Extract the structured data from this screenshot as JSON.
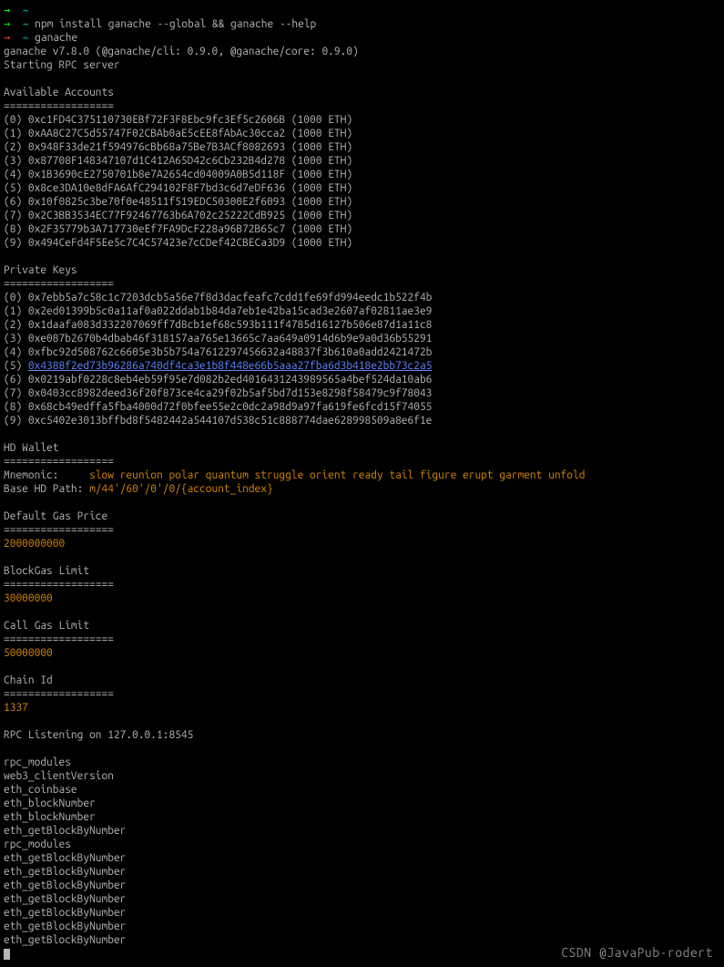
{
  "prompts": [
    {
      "arrow": "→",
      "arrowClass": "arrow-green",
      "tilde": "~",
      "command": ""
    },
    {
      "arrow": "→",
      "arrowClass": "arrow-green",
      "tilde": "~",
      "command": "npm install ganache --global && ganache --help"
    },
    {
      "arrow": "→",
      "arrowClass": "arrow-red",
      "tilde": "~",
      "command": "ganache"
    }
  ],
  "version_line": "ganache v7.8.0 (@ganache/cli: 0.9.0, @ganache/core: 0.9.0)",
  "starting_line": "Starting RPC server",
  "accounts_header": "Available Accounts",
  "separator": "==================",
  "accounts": [
    {
      "idx": "(0)",
      "addr": "0xc1FD4C375110730EBf72F3F8Ebc9fc3Ef5c2606B",
      "bal": "(1000 ETH)"
    },
    {
      "idx": "(1)",
      "addr": "0xAA8C27C5d55747F02CBAb0aE5cEE8fAbAc30cca2",
      "bal": "(1000 ETH)"
    },
    {
      "idx": "(2)",
      "addr": "0x948F33de21f594976cBb68a75Be7B3ACf8082693",
      "bal": "(1000 ETH)"
    },
    {
      "idx": "(3)",
      "addr": "0x87708F148347107d1C412A65D42c6Cb232B4d278",
      "bal": "(1000 ETH)"
    },
    {
      "idx": "(4)",
      "addr": "0x1B3690cE2750701b8e7A2654cd04009A0B5d118F",
      "bal": "(1000 ETH)"
    },
    {
      "idx": "(5)",
      "addr": "0x8ce3DA10e8dFA6AfC294102F8F7bd3c6d7eDF636",
      "bal": "(1000 ETH)"
    },
    {
      "idx": "(6)",
      "addr": "0x10f0825c3be70f0e48511f519EDC50300E2f6093",
      "bal": "(1000 ETH)"
    },
    {
      "idx": "(7)",
      "addr": "0x2C3BB3534EC77F92467763b6A702c25222CdB925",
      "bal": "(1000 ETH)"
    },
    {
      "idx": "(8)",
      "addr": "0x2F35779b3A717730eEf7FA9DcF228a96B72B65c7",
      "bal": "(1000 ETH)"
    },
    {
      "idx": "(9)",
      "addr": "0x494CeFd4F5Ee5c7C4C57423e7cCDef42CBECa3D9",
      "bal": "(1000 ETH)"
    }
  ],
  "pk_header": "Private Keys",
  "private_keys": [
    {
      "idx": "(0)",
      "key": "0x7ebb5a7c58c1c7203dcb5a56e7f8d3dacfeafc7cdd1fe69fd994eedc1b522f4b"
    },
    {
      "idx": "(1)",
      "key": "0x2ed01399b5c0a11af0a022ddab1b84da7eb1e42ba15cad3e2607af02811ae3e9"
    },
    {
      "idx": "(2)",
      "key": "0x1daafa083d332207069ff7d8cb1ef68c593b111f4785d16127b506e87d1a11c8"
    },
    {
      "idx": "(3)",
      "key": "0xe087b2670b4dbab46f318157aa765e13665c7aa649a0914d6b9e9a0d36b55291"
    },
    {
      "idx": "(4)",
      "key": "0xfbc92d508762c6605e3b5b754a7612297456632a48837f3b610a0add2421472b"
    },
    {
      "idx": "(5)",
      "key": "0x4388f2ed73b96286a740df4ca3e1b8f448e66b5aaa27fba6d3b418e2bb73c2a5",
      "link": true
    },
    {
      "idx": "(6)",
      "key": "0x0219abf0228c8eb4eb59f95e7d082b2ed4016431243989565a4bef524da10ab6"
    },
    {
      "idx": "(7)",
      "key": "0x0403cc8982deed36f20f873ce4ca29f02b5af5bd7d153e8298f58479c9f78043"
    },
    {
      "idx": "(8)",
      "key": "0x68cb49edffa5fba4000d72f0bfee55e2c0dc2a98d9a97fa619fe6fcd15f74055"
    },
    {
      "idx": "(9)",
      "key": "0xc5402e3013bffbd8f5482442a544107d538c51c888774dae628998509a8e6f1e"
    }
  ],
  "hd_header": "HD Wallet",
  "mnemonic_label": "Mnemonic:     ",
  "mnemonic_value": "slow reunion polar quantum struggle orient ready tail figure erupt garment unfold",
  "base_path_label": "Base HD Path: ",
  "base_path_value": "m/44'/60'/0'/0/{account_index}",
  "gas_price_header": "Default Gas Price",
  "gas_price_value": "2000000000",
  "block_gas_header": "BlockGas Limit",
  "block_gas_value": "30000000",
  "call_gas_header": "Call Gas Limit",
  "call_gas_value": "50000000",
  "chain_id_header": "Chain Id",
  "chain_id_value": "1337",
  "rpc_listening": "RPC Listening on 127.0.0.1:8545",
  "rpc_calls": [
    "rpc_modules",
    "web3_clientVersion",
    "eth_coinbase",
    "eth_blockNumber",
    "eth_blockNumber",
    "eth_getBlockByNumber",
    "rpc_modules",
    "eth_getBlockByNumber",
    "eth_getBlockByNumber",
    "eth_getBlockByNumber",
    "eth_getBlockByNumber",
    "eth_getBlockByNumber",
    "eth_getBlockByNumber",
    "eth_getBlockByNumber"
  ],
  "watermark": "CSDN @JavaPub-rodert"
}
